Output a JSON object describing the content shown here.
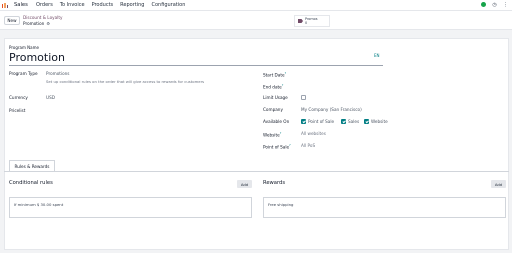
{
  "navbar": {
    "app_name": "Sales",
    "menu": [
      "Orders",
      "To Invoice",
      "Products",
      "Reporting",
      "Configuration"
    ],
    "status_color": "#16a34a"
  },
  "control": {
    "new_label": "New",
    "breadcrumb_parent": "Discount & Loyalty",
    "breadcrumb_current": "Promotion",
    "smart_button": {
      "label": "Promos",
      "count": "0"
    }
  },
  "form": {
    "program_name_label": "Program Name",
    "program_name": "Promotion",
    "lang_code": "EN",
    "program_type_label": "Program Type",
    "program_type": "Promotions",
    "program_type_help": "Set up conditional rules on the order that will give access to rewards for customers",
    "currency_label": "Currency",
    "currency": "USD",
    "pricelist_label": "Pricelist",
    "start_date_label": "Start Date",
    "end_date_label": "End date",
    "limit_usage_label": "Limit Usage",
    "company_label": "Company",
    "company": "My Company (San Francisco)",
    "available_on_label": "Available On",
    "available_on": [
      {
        "label": "Point of Sale",
        "checked": true
      },
      {
        "label": "Sales",
        "checked": true
      },
      {
        "label": "Website",
        "checked": true
      }
    ],
    "website_label": "Website",
    "website": "All websites",
    "pos_label": "Point of Sale",
    "pos": "All PoS",
    "tooltip_mark": "?"
  },
  "tabs": {
    "rules_rewards": "Rules & Rewards"
  },
  "rules": {
    "title": "Conditional rules",
    "add_label": "Add",
    "items": [
      "If minimum $ 30.00 spent"
    ]
  },
  "rewards": {
    "title": "Rewards",
    "add_label": "Add",
    "items": [
      "Free shipping"
    ]
  },
  "colors": {
    "accent": "#714b67",
    "link": "#017e84"
  }
}
